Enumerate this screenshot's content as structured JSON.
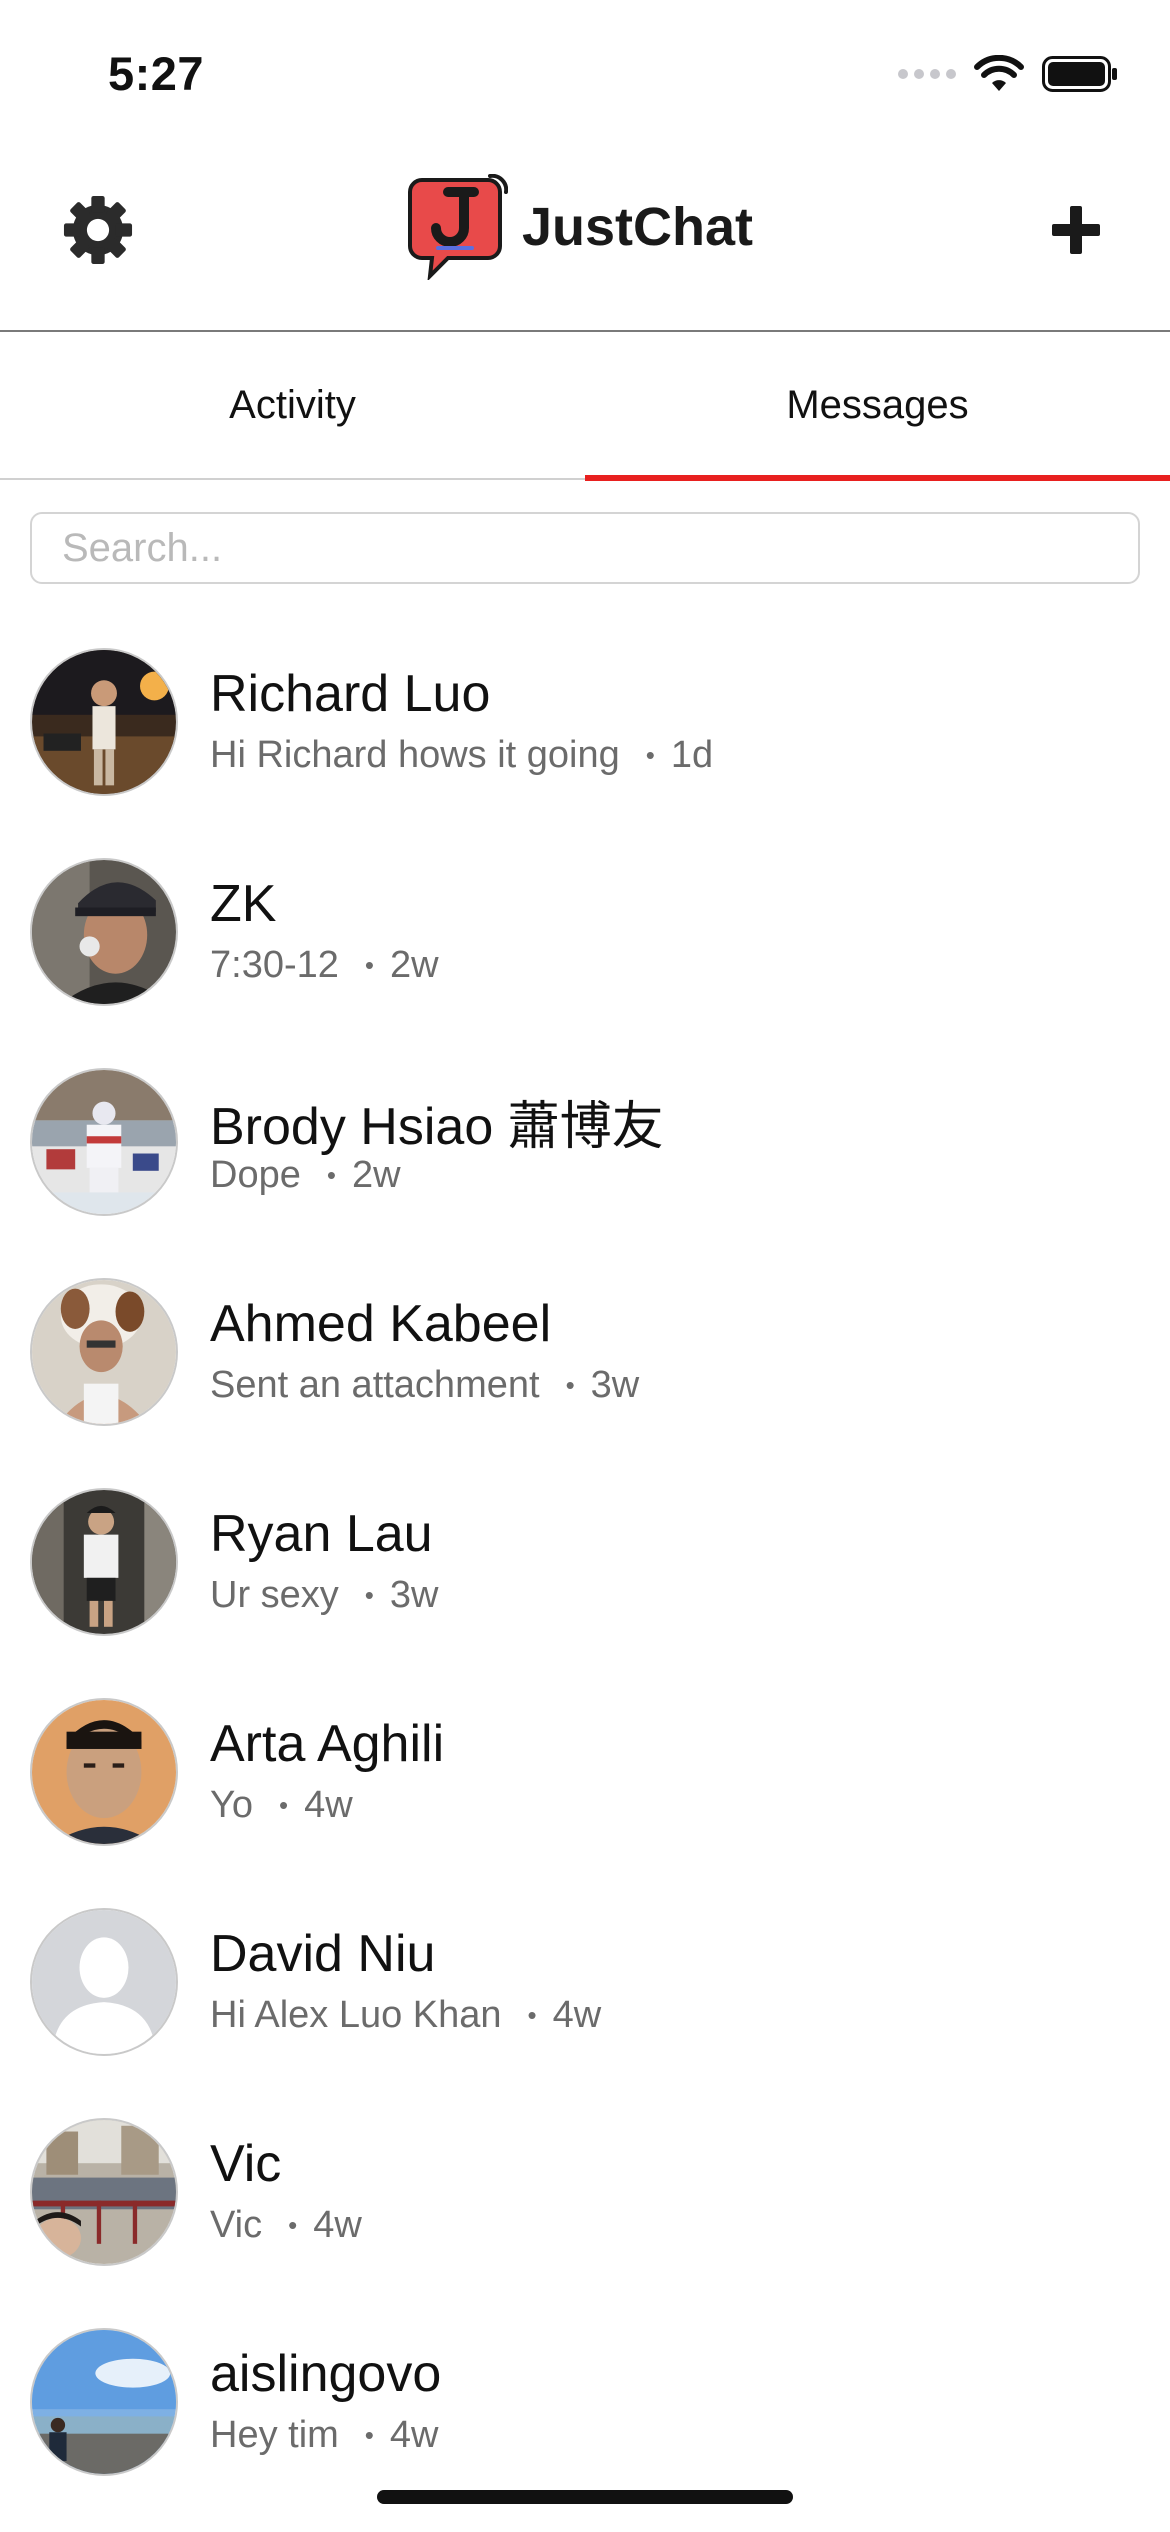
{
  "status_bar": {
    "time": "5:27",
    "icons": [
      "cellular-dots-icon",
      "wifi-icon",
      "battery-icon"
    ]
  },
  "header": {
    "app_name": "JustChat",
    "logo_letter": "J",
    "icons": {
      "left": "gear-icon",
      "right": "plus-icon"
    },
    "accent_color": "#e8201f"
  },
  "tabs": [
    {
      "label": "Activity",
      "active": false
    },
    {
      "label": "Messages",
      "active": true
    }
  ],
  "search": {
    "placeholder": "Search...",
    "value": ""
  },
  "conversations": [
    {
      "name": "Richard Luo",
      "preview": "Hi Richard hows it going",
      "time": "1d"
    },
    {
      "name": "ZK",
      "preview": "7:30-12",
      "time": "2w"
    },
    {
      "name": "Brody Hsiao  蕭博友",
      "preview": "Dope",
      "time": "2w"
    },
    {
      "name": "Ahmed Kabeel",
      "preview": "Sent an attachment",
      "time": "3w"
    },
    {
      "name": "Ryan Lau",
      "preview": "Ur sexy",
      "time": "3w"
    },
    {
      "name": "Arta Aghili",
      "preview": "Yo",
      "time": "4w"
    },
    {
      "name": "David Niu",
      "preview": "Hi Alex Luo Khan",
      "time": "4w"
    },
    {
      "name": "Vic",
      "preview": "Vic",
      "time": "4w"
    },
    {
      "name": "aislingovo",
      "preview": "Hey tim",
      "time": "4w"
    }
  ],
  "separator": "•"
}
